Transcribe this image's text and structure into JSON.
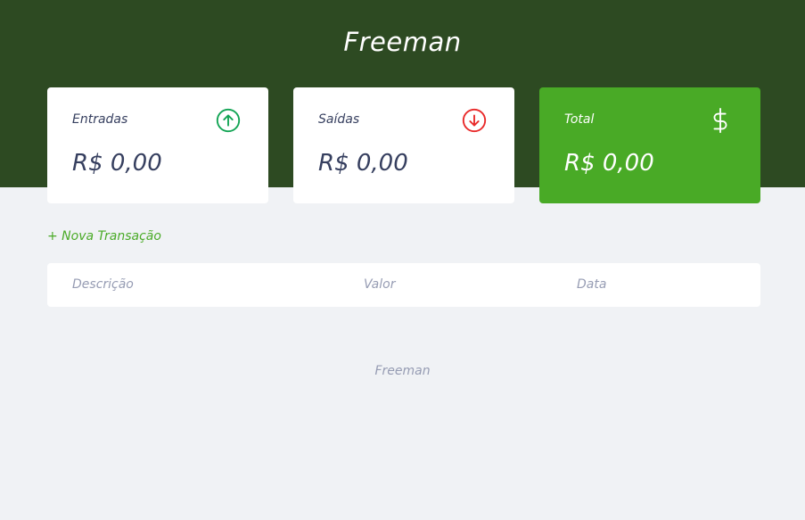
{
  "header": {
    "title": "Freeman",
    "background": "#2d4a22"
  },
  "cards": [
    {
      "label": "Entradas",
      "value": "R$ 0,00",
      "icon": "arrow-up-circle-icon",
      "icon_color": "#12a454"
    },
    {
      "label": "Saídas",
      "value": "R$ 0,00",
      "icon": "arrow-down-circle-icon",
      "icon_color": "#e92929"
    },
    {
      "label": "Total",
      "value": "R$ 0,00",
      "icon": "dollar-icon",
      "background": "#49aa26"
    }
  ],
  "actions": {
    "new_transaction": "+ Nova Transação"
  },
  "table": {
    "headers": [
      "Descrição",
      "Valor",
      "Data"
    ]
  },
  "footer": {
    "text": "Freeman"
  }
}
